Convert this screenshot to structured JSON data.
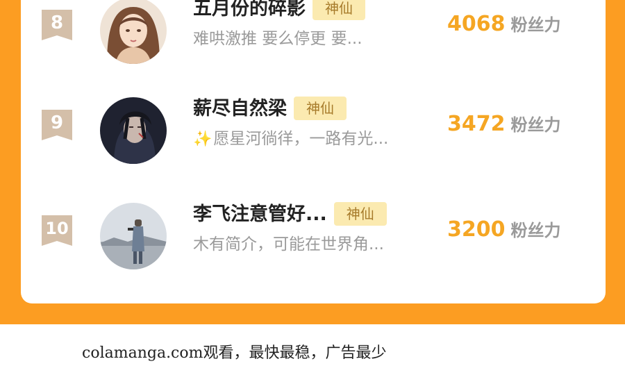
{
  "rows": [
    {
      "rank": "8",
      "name": "五月份的碎影",
      "badge": "神仙",
      "bio": "难哄激推 要么停更 要...",
      "score": "4068",
      "unit": "粉丝力",
      "spark": false
    },
    {
      "rank": "9",
      "name": "薪尽自然梁",
      "badge": "神仙",
      "bio": "愿星河徜徉，一路有光...",
      "score": "3472",
      "unit": "粉丝力",
      "spark": true
    },
    {
      "rank": "10",
      "name": "李飞注意管好...",
      "badge": "神仙",
      "bio": "木有简介，可能在世界角...",
      "score": "3200",
      "unit": "粉丝力",
      "spark": false
    }
  ],
  "footer": {
    "text": "colamanga.com观看，最快最稳，广告最少"
  },
  "colors": {
    "frame": "#fc9d22",
    "score": "#f5a623",
    "badge_bg": "#fbeab0",
    "rank_bg": "#d4bfa9"
  }
}
